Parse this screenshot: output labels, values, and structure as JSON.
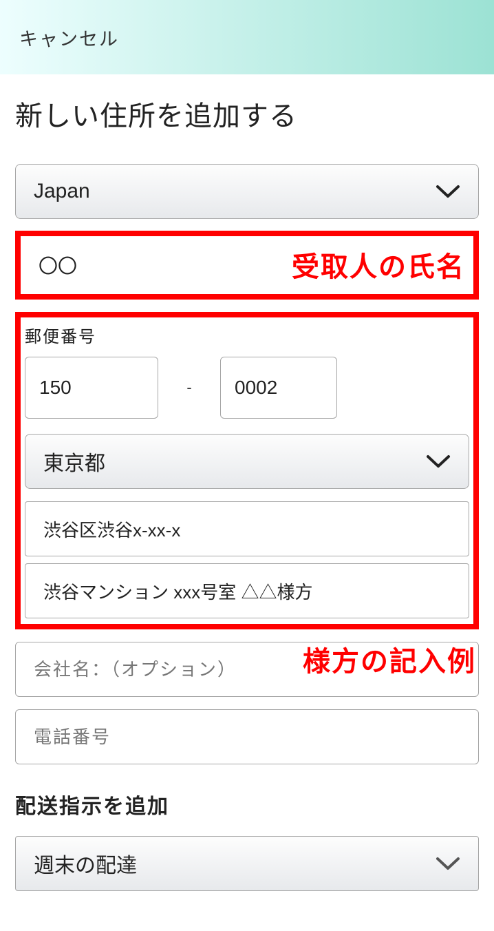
{
  "header": {
    "cancel_label": "キャンセル"
  },
  "page": {
    "title": "新しい住所を追加する"
  },
  "country": {
    "selected": "Japan"
  },
  "recipient": {
    "value": "〇〇"
  },
  "annotations": {
    "recipient": "受取人の氏名",
    "care_of": "様方の記入例"
  },
  "postal": {
    "label": "郵便番号",
    "part1": "150",
    "hyphen": "-",
    "part2": "0002"
  },
  "prefecture": {
    "selected": "東京都"
  },
  "address_line1": {
    "value": "渋谷区渋谷x-xx-x"
  },
  "address_line2": {
    "value": "渋谷マンション xxx号室 △△様方"
  },
  "company": {
    "placeholder": "会社名：（オプション）",
    "value": ""
  },
  "phone": {
    "placeholder": "電話番号",
    "value": ""
  },
  "delivery": {
    "heading": "配送指示を追加",
    "selected": "週末の配達"
  }
}
